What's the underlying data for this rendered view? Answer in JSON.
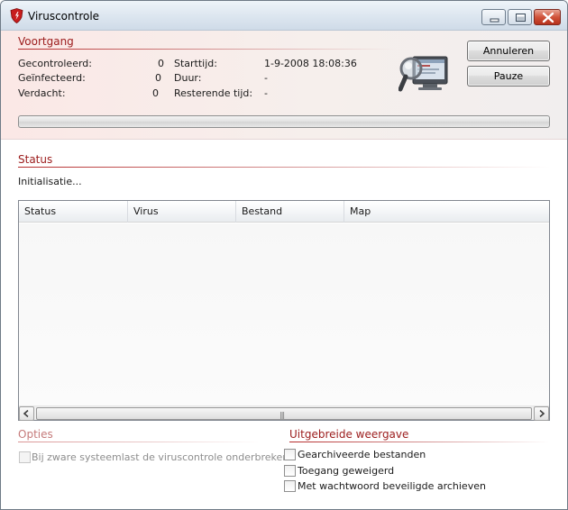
{
  "window": {
    "title": "Viruscontrole",
    "accent": "#9b1b1b"
  },
  "voortgang": {
    "title": "Voortgang",
    "stats": [
      {
        "label": "Gecontroleerd:",
        "value": "0"
      },
      {
        "label": "Geïnfecteerd:",
        "value": "0"
      },
      {
        "label": "Verdacht:",
        "value": "0"
      }
    ],
    "times": [
      {
        "label": "Starttijd:",
        "value": "1-9-2008 18:08:36"
      },
      {
        "label": "Duur:",
        "value": "-"
      },
      {
        "label": "Resterende tijd:",
        "value": "-"
      }
    ],
    "progress_fraction": 0,
    "scan_icon": "magnifier-monitor-icon"
  },
  "buttons": {
    "cancel": "Annuleren",
    "pause": "Pauze"
  },
  "status": {
    "title": "Status",
    "message": "Initialisatie...",
    "columns": [
      "Status",
      "Virus",
      "Bestand",
      "Map"
    ],
    "rows": []
  },
  "opties": {
    "title": "Opties",
    "interrupt_label": "Bij zware systeemlast de viruscontrole onderbreken",
    "interrupt_checked": false,
    "enabled": false
  },
  "uitgebreide": {
    "title": "Uitgebreide weergave",
    "options": [
      {
        "label": "Gearchiveerde bestanden",
        "checked": false
      },
      {
        "label": "Toegang geweigerd",
        "checked": false
      },
      {
        "label": "Met wachtwoord beveiligde archieven",
        "checked": false
      }
    ]
  }
}
